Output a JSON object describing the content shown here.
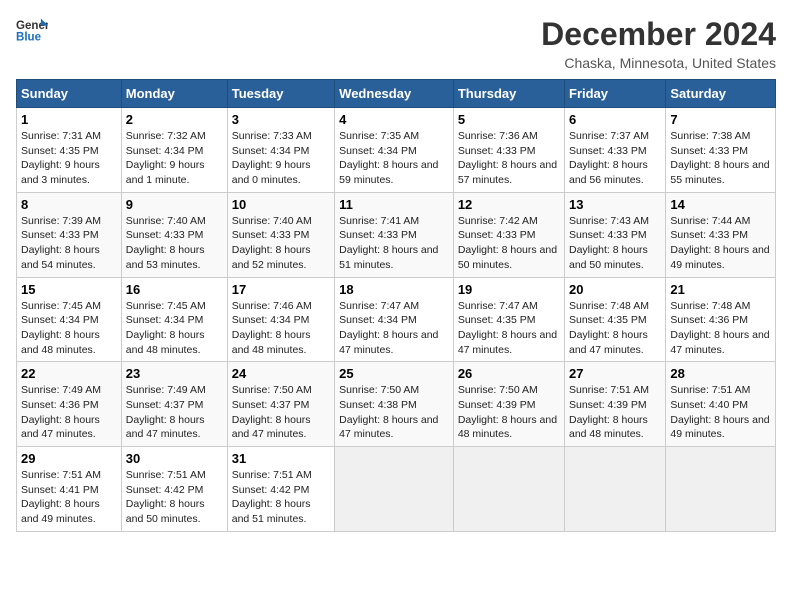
{
  "header": {
    "logo_line1": "General",
    "logo_line2": "Blue",
    "title": "December 2024",
    "subtitle": "Chaska, Minnesota, United States"
  },
  "days_of_week": [
    "Sunday",
    "Monday",
    "Tuesday",
    "Wednesday",
    "Thursday",
    "Friday",
    "Saturday"
  ],
  "weeks": [
    [
      {
        "num": "1",
        "rise": "7:31 AM",
        "set": "4:35 PM",
        "daylight": "9 hours and 3 minutes."
      },
      {
        "num": "2",
        "rise": "7:32 AM",
        "set": "4:34 PM",
        "daylight": "9 hours and 1 minute."
      },
      {
        "num": "3",
        "rise": "7:33 AM",
        "set": "4:34 PM",
        "daylight": "9 hours and 0 minutes."
      },
      {
        "num": "4",
        "rise": "7:35 AM",
        "set": "4:34 PM",
        "daylight": "8 hours and 59 minutes."
      },
      {
        "num": "5",
        "rise": "7:36 AM",
        "set": "4:33 PM",
        "daylight": "8 hours and 57 minutes."
      },
      {
        "num": "6",
        "rise": "7:37 AM",
        "set": "4:33 PM",
        "daylight": "8 hours and 56 minutes."
      },
      {
        "num": "7",
        "rise": "7:38 AM",
        "set": "4:33 PM",
        "daylight": "8 hours and 55 minutes."
      }
    ],
    [
      {
        "num": "8",
        "rise": "7:39 AM",
        "set": "4:33 PM",
        "daylight": "8 hours and 54 minutes."
      },
      {
        "num": "9",
        "rise": "7:40 AM",
        "set": "4:33 PM",
        "daylight": "8 hours and 53 minutes."
      },
      {
        "num": "10",
        "rise": "7:40 AM",
        "set": "4:33 PM",
        "daylight": "8 hours and 52 minutes."
      },
      {
        "num": "11",
        "rise": "7:41 AM",
        "set": "4:33 PM",
        "daylight": "8 hours and 51 minutes."
      },
      {
        "num": "12",
        "rise": "7:42 AM",
        "set": "4:33 PM",
        "daylight": "8 hours and 50 minutes."
      },
      {
        "num": "13",
        "rise": "7:43 AM",
        "set": "4:33 PM",
        "daylight": "8 hours and 50 minutes."
      },
      {
        "num": "14",
        "rise": "7:44 AM",
        "set": "4:33 PM",
        "daylight": "8 hours and 49 minutes."
      }
    ],
    [
      {
        "num": "15",
        "rise": "7:45 AM",
        "set": "4:34 PM",
        "daylight": "8 hours and 48 minutes."
      },
      {
        "num": "16",
        "rise": "7:45 AM",
        "set": "4:34 PM",
        "daylight": "8 hours and 48 minutes."
      },
      {
        "num": "17",
        "rise": "7:46 AM",
        "set": "4:34 PM",
        "daylight": "8 hours and 48 minutes."
      },
      {
        "num": "18",
        "rise": "7:47 AM",
        "set": "4:34 PM",
        "daylight": "8 hours and 47 minutes."
      },
      {
        "num": "19",
        "rise": "7:47 AM",
        "set": "4:35 PM",
        "daylight": "8 hours and 47 minutes."
      },
      {
        "num": "20",
        "rise": "7:48 AM",
        "set": "4:35 PM",
        "daylight": "8 hours and 47 minutes."
      },
      {
        "num": "21",
        "rise": "7:48 AM",
        "set": "4:36 PM",
        "daylight": "8 hours and 47 minutes."
      }
    ],
    [
      {
        "num": "22",
        "rise": "7:49 AM",
        "set": "4:36 PM",
        "daylight": "8 hours and 47 minutes."
      },
      {
        "num": "23",
        "rise": "7:49 AM",
        "set": "4:37 PM",
        "daylight": "8 hours and 47 minutes."
      },
      {
        "num": "24",
        "rise": "7:50 AM",
        "set": "4:37 PM",
        "daylight": "8 hours and 47 minutes."
      },
      {
        "num": "25",
        "rise": "7:50 AM",
        "set": "4:38 PM",
        "daylight": "8 hours and 47 minutes."
      },
      {
        "num": "26",
        "rise": "7:50 AM",
        "set": "4:39 PM",
        "daylight": "8 hours and 48 minutes."
      },
      {
        "num": "27",
        "rise": "7:51 AM",
        "set": "4:39 PM",
        "daylight": "8 hours and 48 minutes."
      },
      {
        "num": "28",
        "rise": "7:51 AM",
        "set": "4:40 PM",
        "daylight": "8 hours and 49 minutes."
      }
    ],
    [
      {
        "num": "29",
        "rise": "7:51 AM",
        "set": "4:41 PM",
        "daylight": "8 hours and 49 minutes."
      },
      {
        "num": "30",
        "rise": "7:51 AM",
        "set": "4:42 PM",
        "daylight": "8 hours and 50 minutes."
      },
      {
        "num": "31",
        "rise": "7:51 AM",
        "set": "4:42 PM",
        "daylight": "8 hours and 51 minutes."
      },
      null,
      null,
      null,
      null
    ]
  ]
}
